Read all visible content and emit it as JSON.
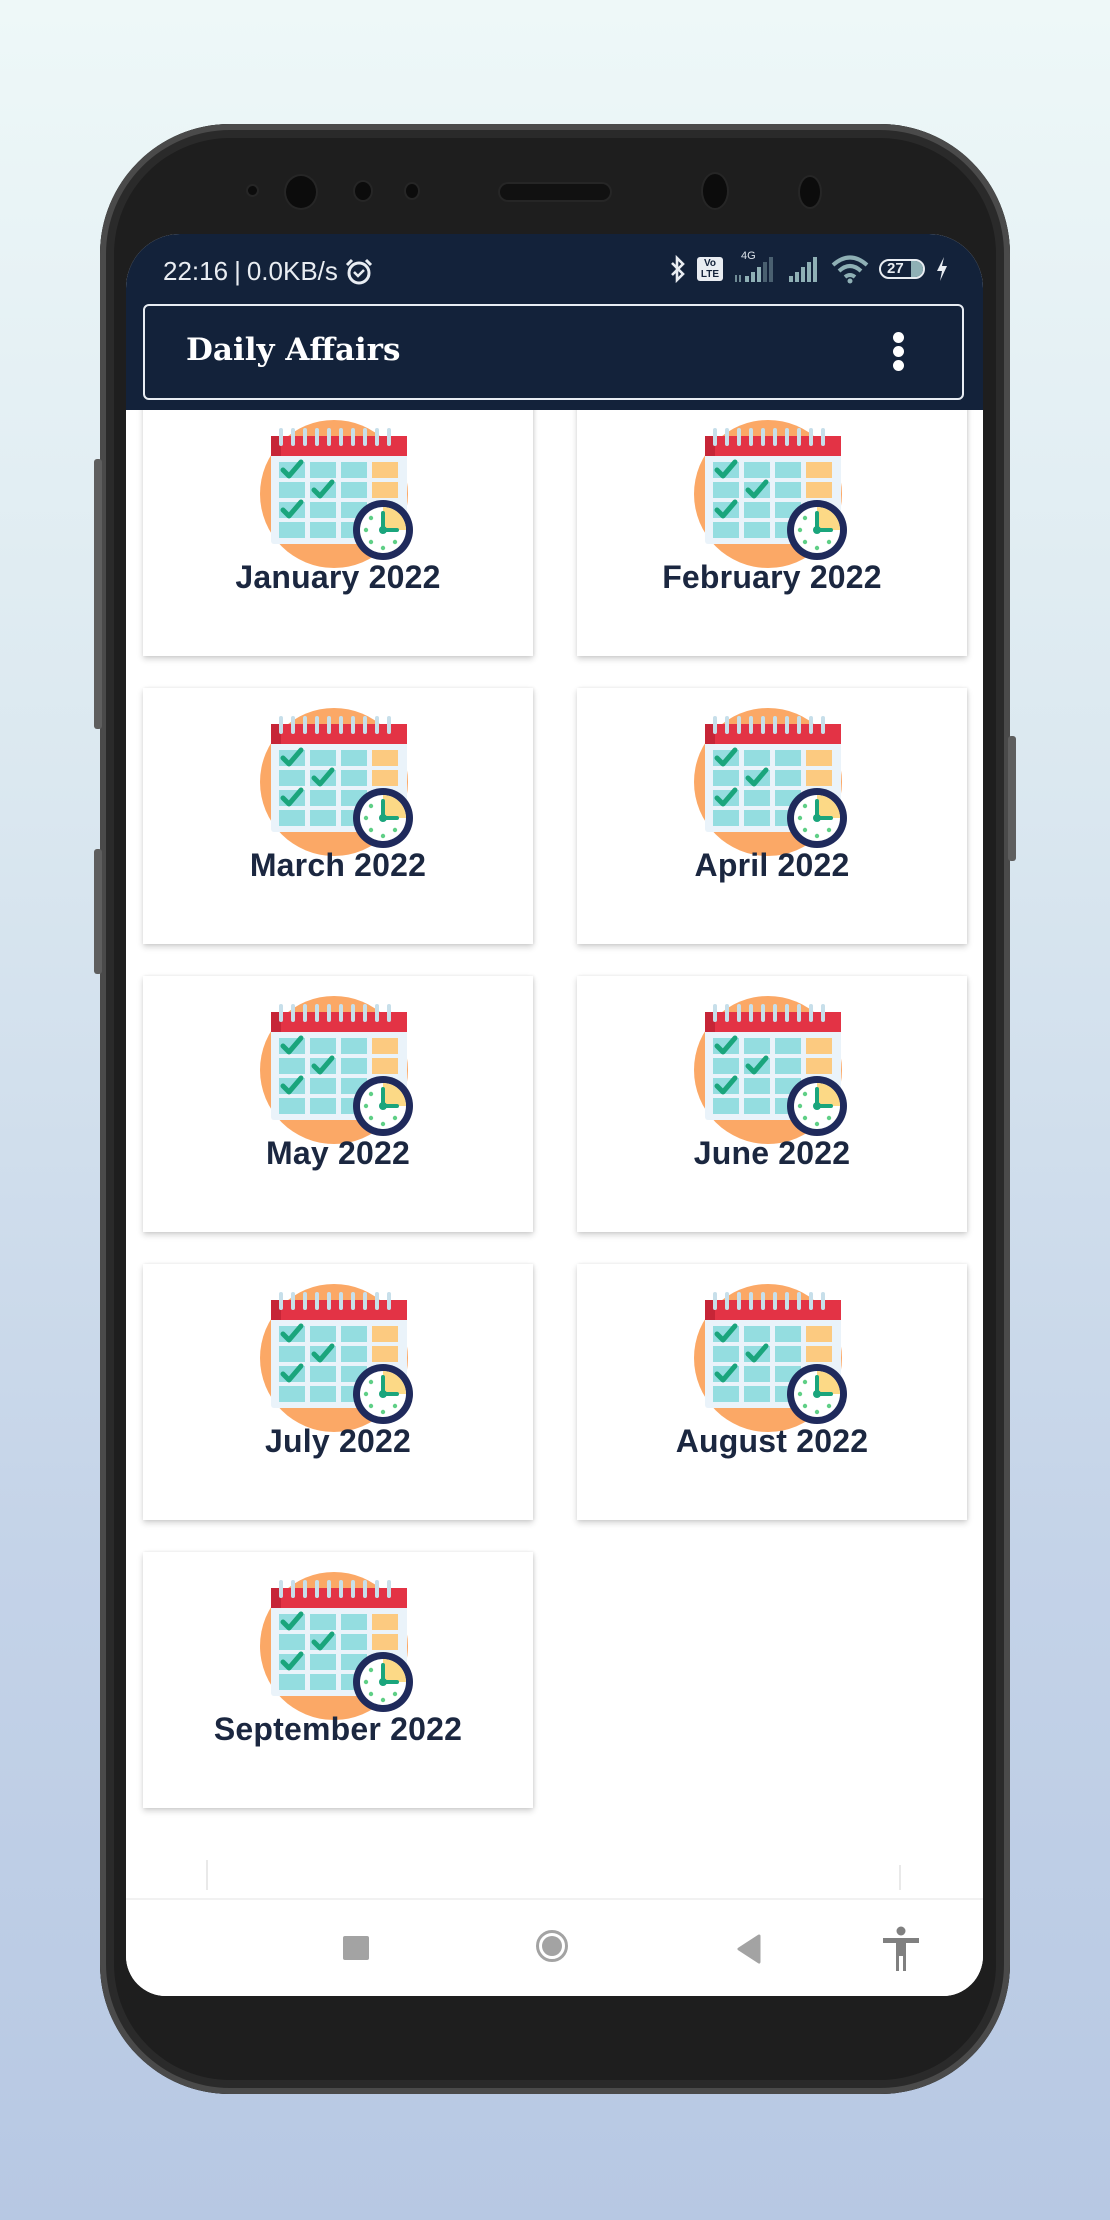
{
  "status_bar": {
    "time": "22:16",
    "separator": "|",
    "network_speed": "0.0KB/s",
    "alarm_icon": "alarm-clock-icon",
    "icons": [
      "bluetooth-icon",
      "volte-icon",
      "signal-4g-icon",
      "signal-icon",
      "wifi-icon",
      "battery-icon",
      "charging-icon"
    ],
    "network_type": "4G",
    "volte_label_top": "Vo",
    "volte_label_bottom": "LTE",
    "battery_level": "27"
  },
  "app_bar": {
    "title": "Daily Affairs",
    "menu_icon": "more-vertical-icon"
  },
  "months": [
    {
      "label": "January 2022",
      "icon": "calendar-clock-icon"
    },
    {
      "label": "February 2022",
      "icon": "calendar-clock-icon"
    },
    {
      "label": "March 2022",
      "icon": "calendar-clock-icon"
    },
    {
      "label": "April 2022",
      "icon": "calendar-clock-icon"
    },
    {
      "label": "May 2022",
      "icon": "calendar-clock-icon"
    },
    {
      "label": "June 2022",
      "icon": "calendar-clock-icon"
    },
    {
      "label": "July 2022",
      "icon": "calendar-clock-icon"
    },
    {
      "label": "August 2022",
      "icon": "calendar-clock-icon"
    },
    {
      "label": "September 2022",
      "icon": "calendar-clock-icon"
    }
  ],
  "nav_bar": {
    "buttons": [
      "recents-icon",
      "home-icon",
      "back-icon",
      "accessibility-icon"
    ]
  },
  "colors": {
    "header_bg": "#13223a",
    "label_text": "#1b2740",
    "calendar_red": "#e33345",
    "calendar_cell": "#94dde0",
    "calendar_orange_circle": "#fba866",
    "clock_ring": "#1f2a5c",
    "check_green": "#1aa57c"
  }
}
